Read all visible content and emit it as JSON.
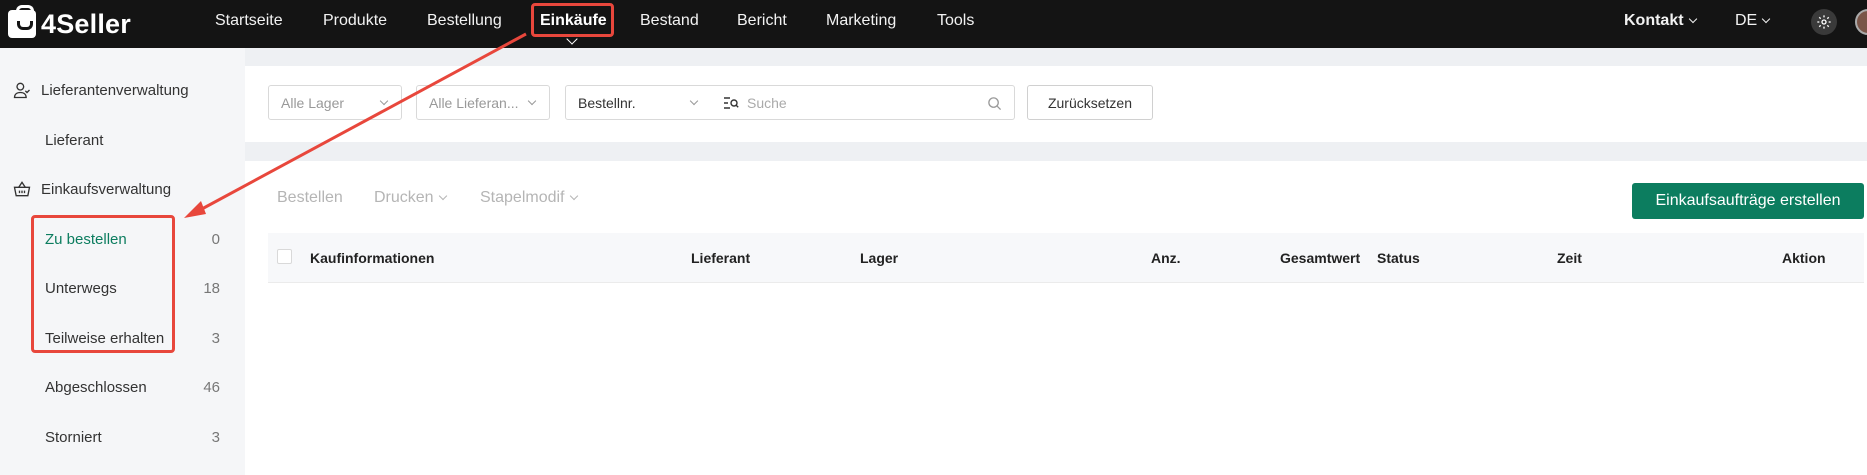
{
  "app": {
    "brand": "4Seller"
  },
  "nav": {
    "items": [
      "Startseite",
      "Produkte",
      "Bestellung",
      "Einkäufe",
      "Bestand",
      "Bericht",
      "Marketing",
      "Tools"
    ],
    "active": "Einkäufe",
    "contact": "Kontakt",
    "language": "DE"
  },
  "sidebar": {
    "groups": [
      {
        "label": "Lieferantenverwaltung",
        "icon": "user-icon",
        "items": [
          {
            "label": "Lieferant"
          }
        ]
      },
      {
        "label": "Einkaufsverwaltung",
        "icon": "basket-icon",
        "items": [
          {
            "label": "Zu bestellen",
            "count": "0",
            "active": true
          },
          {
            "label": "Unterwegs",
            "count": "18"
          },
          {
            "label": "Teilweise erhalten",
            "count": "3"
          },
          {
            "label": "Abgeschlossen",
            "count": "46"
          },
          {
            "label": "Storniert",
            "count": "3"
          }
        ]
      }
    ]
  },
  "filters": {
    "warehouse": "Alle Lager",
    "supplier": "Alle Lieferan...",
    "search_field": "Bestellnr.",
    "search_placeholder": "Suche",
    "reset_label": "Zurücksetzen"
  },
  "toolbar": {
    "order": "Bestellen",
    "print": "Drucken",
    "batch_edit": "Stapelmodif",
    "create": "Einkaufsaufträge erstellen"
  },
  "table": {
    "columns": [
      "Kaufinformationen",
      "Lieferant",
      "Lager",
      "Anz.",
      "Gesamtwert",
      "Status",
      "Zeit",
      "Aktion"
    ]
  },
  "colors": {
    "accent": "#0c7d5f",
    "topbar": "#141414",
    "annotation": "#e8473c"
  }
}
